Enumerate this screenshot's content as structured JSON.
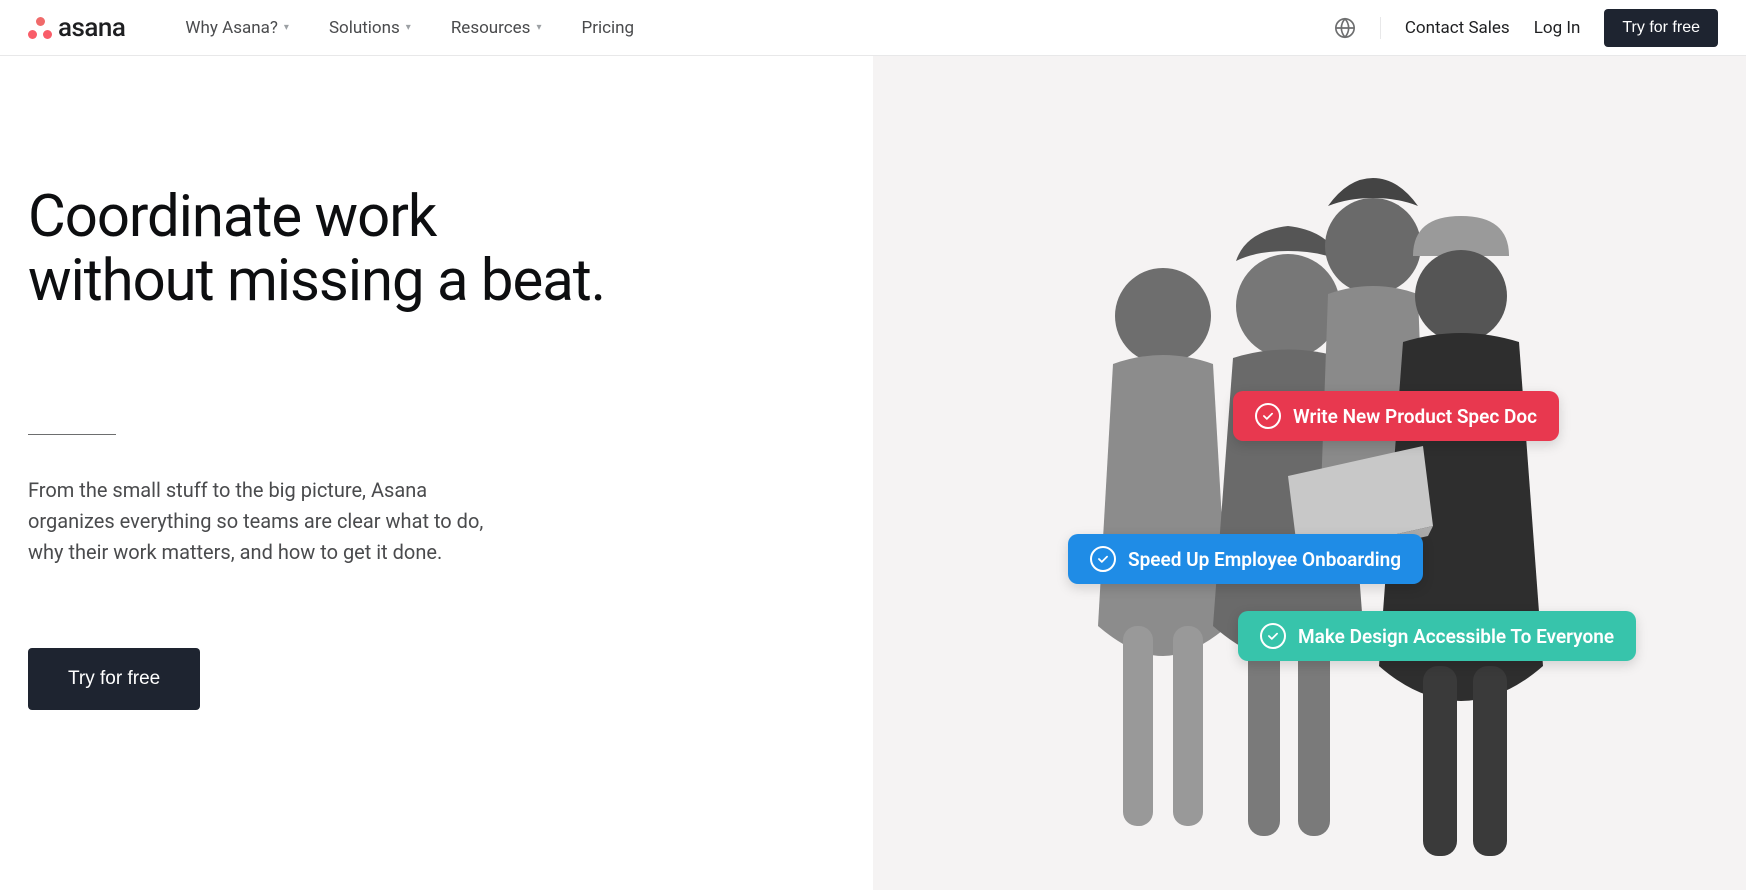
{
  "brand": "asana",
  "nav": {
    "items": [
      {
        "label": "Why Asana?",
        "hasDropdown": true
      },
      {
        "label": "Solutions",
        "hasDropdown": true
      },
      {
        "label": "Resources",
        "hasDropdown": true
      },
      {
        "label": "Pricing",
        "hasDropdown": false
      }
    ]
  },
  "header": {
    "contact": "Contact Sales",
    "login": "Log In",
    "cta": "Try for free"
  },
  "hero": {
    "headline_l1": "Coordinate work",
    "headline_l2": "without missing a beat.",
    "subtext": "From the small stuff to the big picture, Asana organizes everything so teams are clear what to do, why their work matters, and how to get it done.",
    "cta": "Try for free"
  },
  "pills": [
    {
      "label": "Write New Product Spec Doc",
      "color": "red"
    },
    {
      "label": "Speed Up Employee Onboarding",
      "color": "blue"
    },
    {
      "label": "Make Design Accessible To Everyone",
      "color": "green"
    }
  ]
}
